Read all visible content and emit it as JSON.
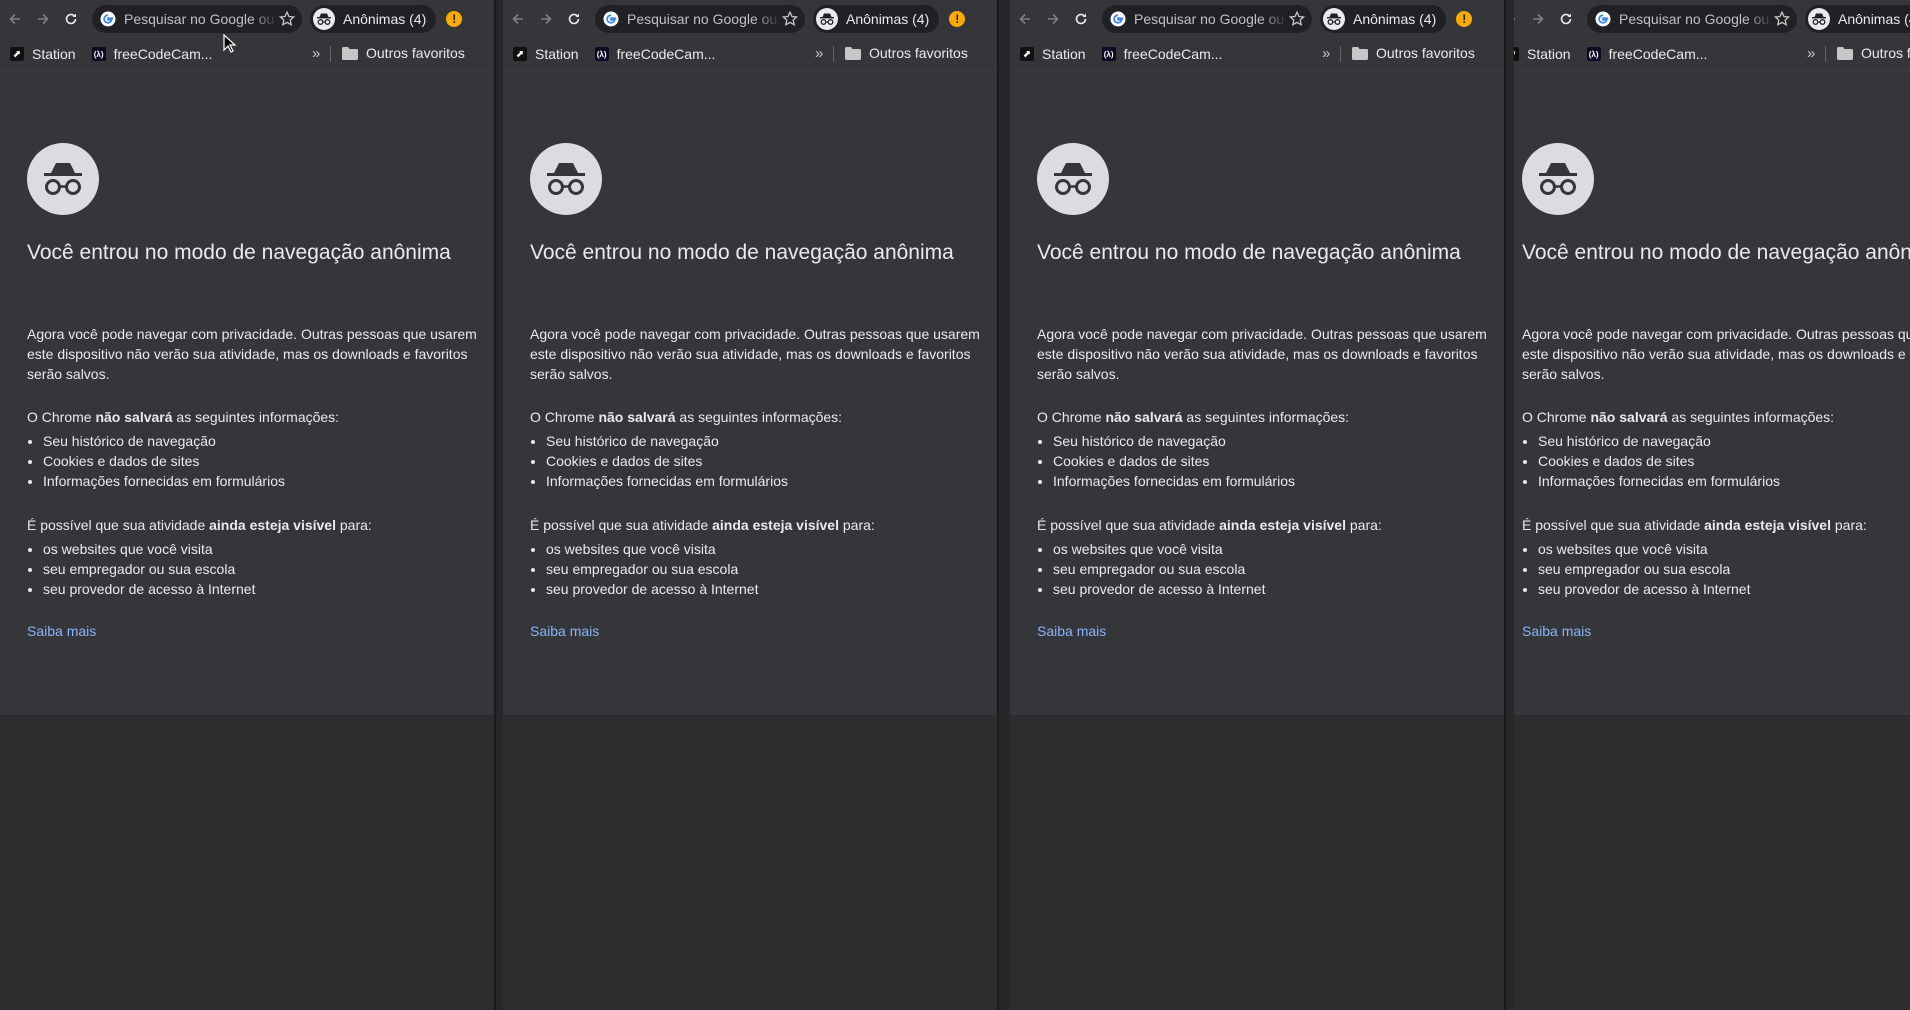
{
  "toolbar": {
    "omnibox_text": "Pesquisar no Google ou digitar URL",
    "profile_label": "Anônimas (4)",
    "alert": "!"
  },
  "bookmarks": {
    "items": [
      {
        "label": "Station",
        "icon": "station-icon"
      },
      {
        "label": "freeCodeCam...",
        "icon": "freecodecamp-icon"
      }
    ],
    "more": "»",
    "folder_label": "Outros favoritos"
  },
  "incognito_page": {
    "heading": "Você entrou no modo de navegação anônima",
    "intro": "Agora você pode navegar com privacidade. Outras pessoas que usarem este dispositivo não verão sua atividade, mas os downloads e favoritos serão salvos.",
    "not_saved": {
      "prefix": "O Chrome ",
      "bold": "não salvará",
      "suffix": " as seguintes informações:",
      "items": [
        "Seu histórico de navegação",
        "Cookies e dados de sites",
        "Informações fornecidas em formulários"
      ]
    },
    "visible": {
      "prefix": "É possível que sua atividade ",
      "bold": "ainda esteja visível",
      "suffix": " para:",
      "items": [
        "os websites que você visita",
        "seu empregador ou sua escola",
        "seu provedor de acesso à Internet"
      ]
    },
    "learn_more": "Saiba mais"
  },
  "colors": {
    "toolbar": "#35363a",
    "omnibox": "#202124",
    "link": "#8ab4f8",
    "alert": "#f9ab00"
  }
}
